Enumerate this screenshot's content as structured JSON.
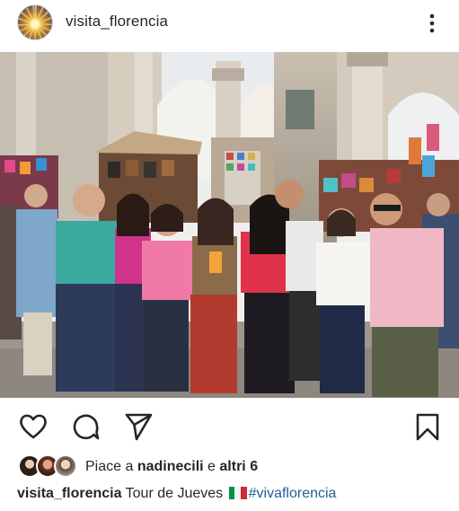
{
  "post": {
    "username": "visita_florencia",
    "avatar_icon": "sun-avatar",
    "more_icon": "more-vertical-icon"
  },
  "photo": {
    "subject": "group-photo-florence-market"
  },
  "actions": {
    "like_icon": "heart-icon",
    "comment_icon": "comment-icon",
    "share_icon": "send-icon",
    "save_icon": "bookmark-icon"
  },
  "likes": {
    "prefix": "Piace a ",
    "first_user": "nadinecili",
    "connector": " e ",
    "others": "altri 6"
  },
  "caption": {
    "username": "visita_florencia",
    "text": "Tour de Jueves",
    "flag": "italy-flag",
    "hashtag": "#vivaflorencia"
  },
  "colors": {
    "text": "#262626",
    "hashtag": "#2a5a9a",
    "flag_green": "#009246",
    "flag_white": "#ffffff",
    "flag_red": "#ce2b37"
  }
}
